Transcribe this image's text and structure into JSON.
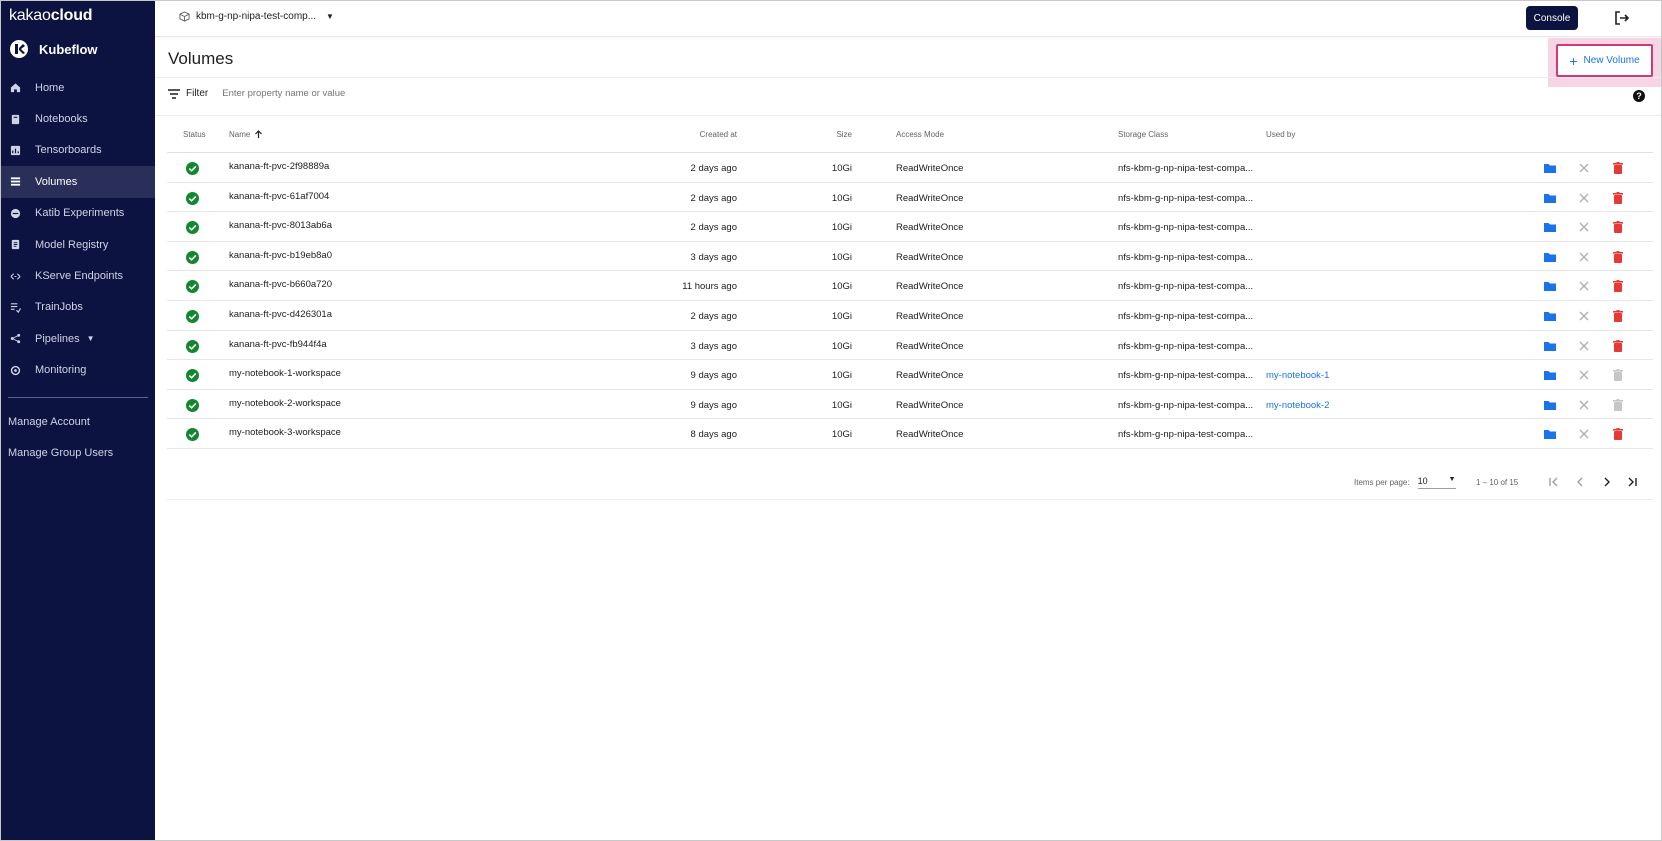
{
  "brand": {
    "prefix": "kakao",
    "suffix": "cloud",
    "product": "Kubeflow"
  },
  "sidebar": {
    "items": [
      {
        "label": "Home",
        "icon": "home-icon"
      },
      {
        "label": "Notebooks",
        "icon": "book-icon"
      },
      {
        "label": "Tensorboards",
        "icon": "chart-icon"
      },
      {
        "label": "Volumes",
        "icon": "storage-icon",
        "active": true
      },
      {
        "label": "Katib Experiments",
        "icon": "katib-icon"
      },
      {
        "label": "Model Registry",
        "icon": "registry-icon"
      },
      {
        "label": "KServe Endpoints",
        "icon": "endpoint-icon"
      },
      {
        "label": "TrainJobs",
        "icon": "trainjob-icon"
      },
      {
        "label": "Pipelines",
        "icon": "pipeline-icon",
        "has_dropdown": true
      },
      {
        "label": "Monitoring",
        "icon": "monitoring-icon"
      }
    ],
    "manage_account": "Manage Account",
    "manage_group_users": "Manage Group Users"
  },
  "topbar": {
    "namespace": "kbm-g-np-nipa-test-comp...",
    "console_label": "Console"
  },
  "page": {
    "title": "Volumes",
    "new_button_label": "New Volume"
  },
  "filter": {
    "label": "Filter",
    "placeholder": "Enter property name or value"
  },
  "table": {
    "headers": {
      "status": "Status",
      "name": "Name",
      "created": "Created at",
      "size": "Size",
      "access": "Access Mode",
      "storage": "Storage Class",
      "used_by": "Used by"
    },
    "rows": [
      {
        "name": "kanana-ft-pvc-2f98889a",
        "created": "2 days ago",
        "size": "10Gi",
        "access": "ReadWriteOnce",
        "storage": "nfs-kbm-g-np-nipa-test-compa...",
        "used_by": "",
        "delete_enabled": true
      },
      {
        "name": "kanana-ft-pvc-61af7004",
        "created": "2 days ago",
        "size": "10Gi",
        "access": "ReadWriteOnce",
        "storage": "nfs-kbm-g-np-nipa-test-compa...",
        "used_by": "",
        "delete_enabled": true
      },
      {
        "name": "kanana-ft-pvc-8013ab6a",
        "created": "2 days ago",
        "size": "10Gi",
        "access": "ReadWriteOnce",
        "storage": "nfs-kbm-g-np-nipa-test-compa...",
        "used_by": "",
        "delete_enabled": true
      },
      {
        "name": "kanana-ft-pvc-b19eb8a0",
        "created": "3 days ago",
        "size": "10Gi",
        "access": "ReadWriteOnce",
        "storage": "nfs-kbm-g-np-nipa-test-compa...",
        "used_by": "",
        "delete_enabled": true
      },
      {
        "name": "kanana-ft-pvc-b660a720",
        "created": "11 hours ago",
        "size": "10Gi",
        "access": "ReadWriteOnce",
        "storage": "nfs-kbm-g-np-nipa-test-compa...",
        "used_by": "",
        "delete_enabled": true
      },
      {
        "name": "kanana-ft-pvc-d426301a",
        "created": "2 days ago",
        "size": "10Gi",
        "access": "ReadWriteOnce",
        "storage": "nfs-kbm-g-np-nipa-test-compa...",
        "used_by": "",
        "delete_enabled": true
      },
      {
        "name": "kanana-ft-pvc-fb944f4a",
        "created": "3 days ago",
        "size": "10Gi",
        "access": "ReadWriteOnce",
        "storage": "nfs-kbm-g-np-nipa-test-compa...",
        "used_by": "",
        "delete_enabled": true
      },
      {
        "name": "my-notebook-1-workspace",
        "created": "9 days ago",
        "size": "10Gi",
        "access": "ReadWriteOnce",
        "storage": "nfs-kbm-g-np-nipa-test-compa...",
        "used_by": "my-notebook-1",
        "delete_enabled": false
      },
      {
        "name": "my-notebook-2-workspace",
        "created": "9 days ago",
        "size": "10Gi",
        "access": "ReadWriteOnce",
        "storage": "nfs-kbm-g-np-nipa-test-compa...",
        "used_by": "my-notebook-2",
        "delete_enabled": false
      },
      {
        "name": "my-notebook-3-workspace",
        "created": "8 days ago",
        "size": "10Gi",
        "access": "ReadWriteOnce",
        "storage": "nfs-kbm-g-np-nipa-test-compa...",
        "used_by": "",
        "delete_enabled": true
      }
    ]
  },
  "pagination": {
    "items_per_page_label": "Items per page:",
    "items_per_page": "10",
    "range": "1 – 10 of 15"
  },
  "colors": {
    "sidebar_bg": "#0d1340",
    "accent": "#1a73e8",
    "status_ok": "#12872f",
    "delete": "#e53935",
    "highlight": "#d03a7c"
  }
}
